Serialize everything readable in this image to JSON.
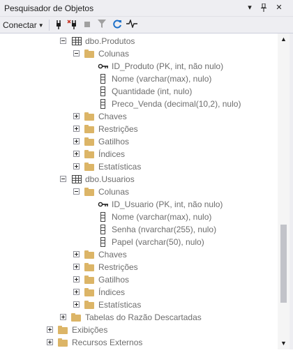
{
  "window": {
    "title": "Pesquisador de Objetos",
    "dropdown_icon": "chevron-down-icon",
    "pin_icon": "pin-icon",
    "close_icon": "close-icon"
  },
  "toolbar": {
    "connect_label": "Conectar",
    "tools": [
      "connect-icon",
      "disconnect-icon",
      "stop-icon",
      "filter-icon",
      "refresh-icon",
      "activity-monitor-icon"
    ]
  },
  "tree": {
    "produtos": {
      "label": "dbo.Produtos",
      "colunas": "Colunas",
      "columns": [
        "ID_Produto (PK, int, não nulo)",
        "Nome (varchar(max), nulo)",
        "Quantidade (int, nulo)",
        "Preco_Venda (decimal(10,2), nulo)"
      ],
      "folders": [
        "Chaves",
        "Restrições",
        "Gatilhos",
        "Índices",
        "Estatísticas"
      ]
    },
    "usuarios": {
      "label": "dbo.Usuarios",
      "colunas": "Colunas",
      "columns": [
        "ID_Usuario (PK, int, não nulo)",
        "Nome (varchar(max), nulo)",
        "Senha (nvarchar(255), nulo)",
        "Papel (varchar(50), nulo)"
      ],
      "folders": [
        "Chaves",
        "Restrições",
        "Gatilhos",
        "Índices",
        "Estatísticas"
      ]
    },
    "tabelas_razao": "Tabelas do Razão Descartadas",
    "exibicoes": "Exibições",
    "recursos_externos": "Recursos Externos"
  },
  "colors": {
    "folder": "#dcb567",
    "chrome": "#eeeef2",
    "text": "#6d6d6d"
  }
}
